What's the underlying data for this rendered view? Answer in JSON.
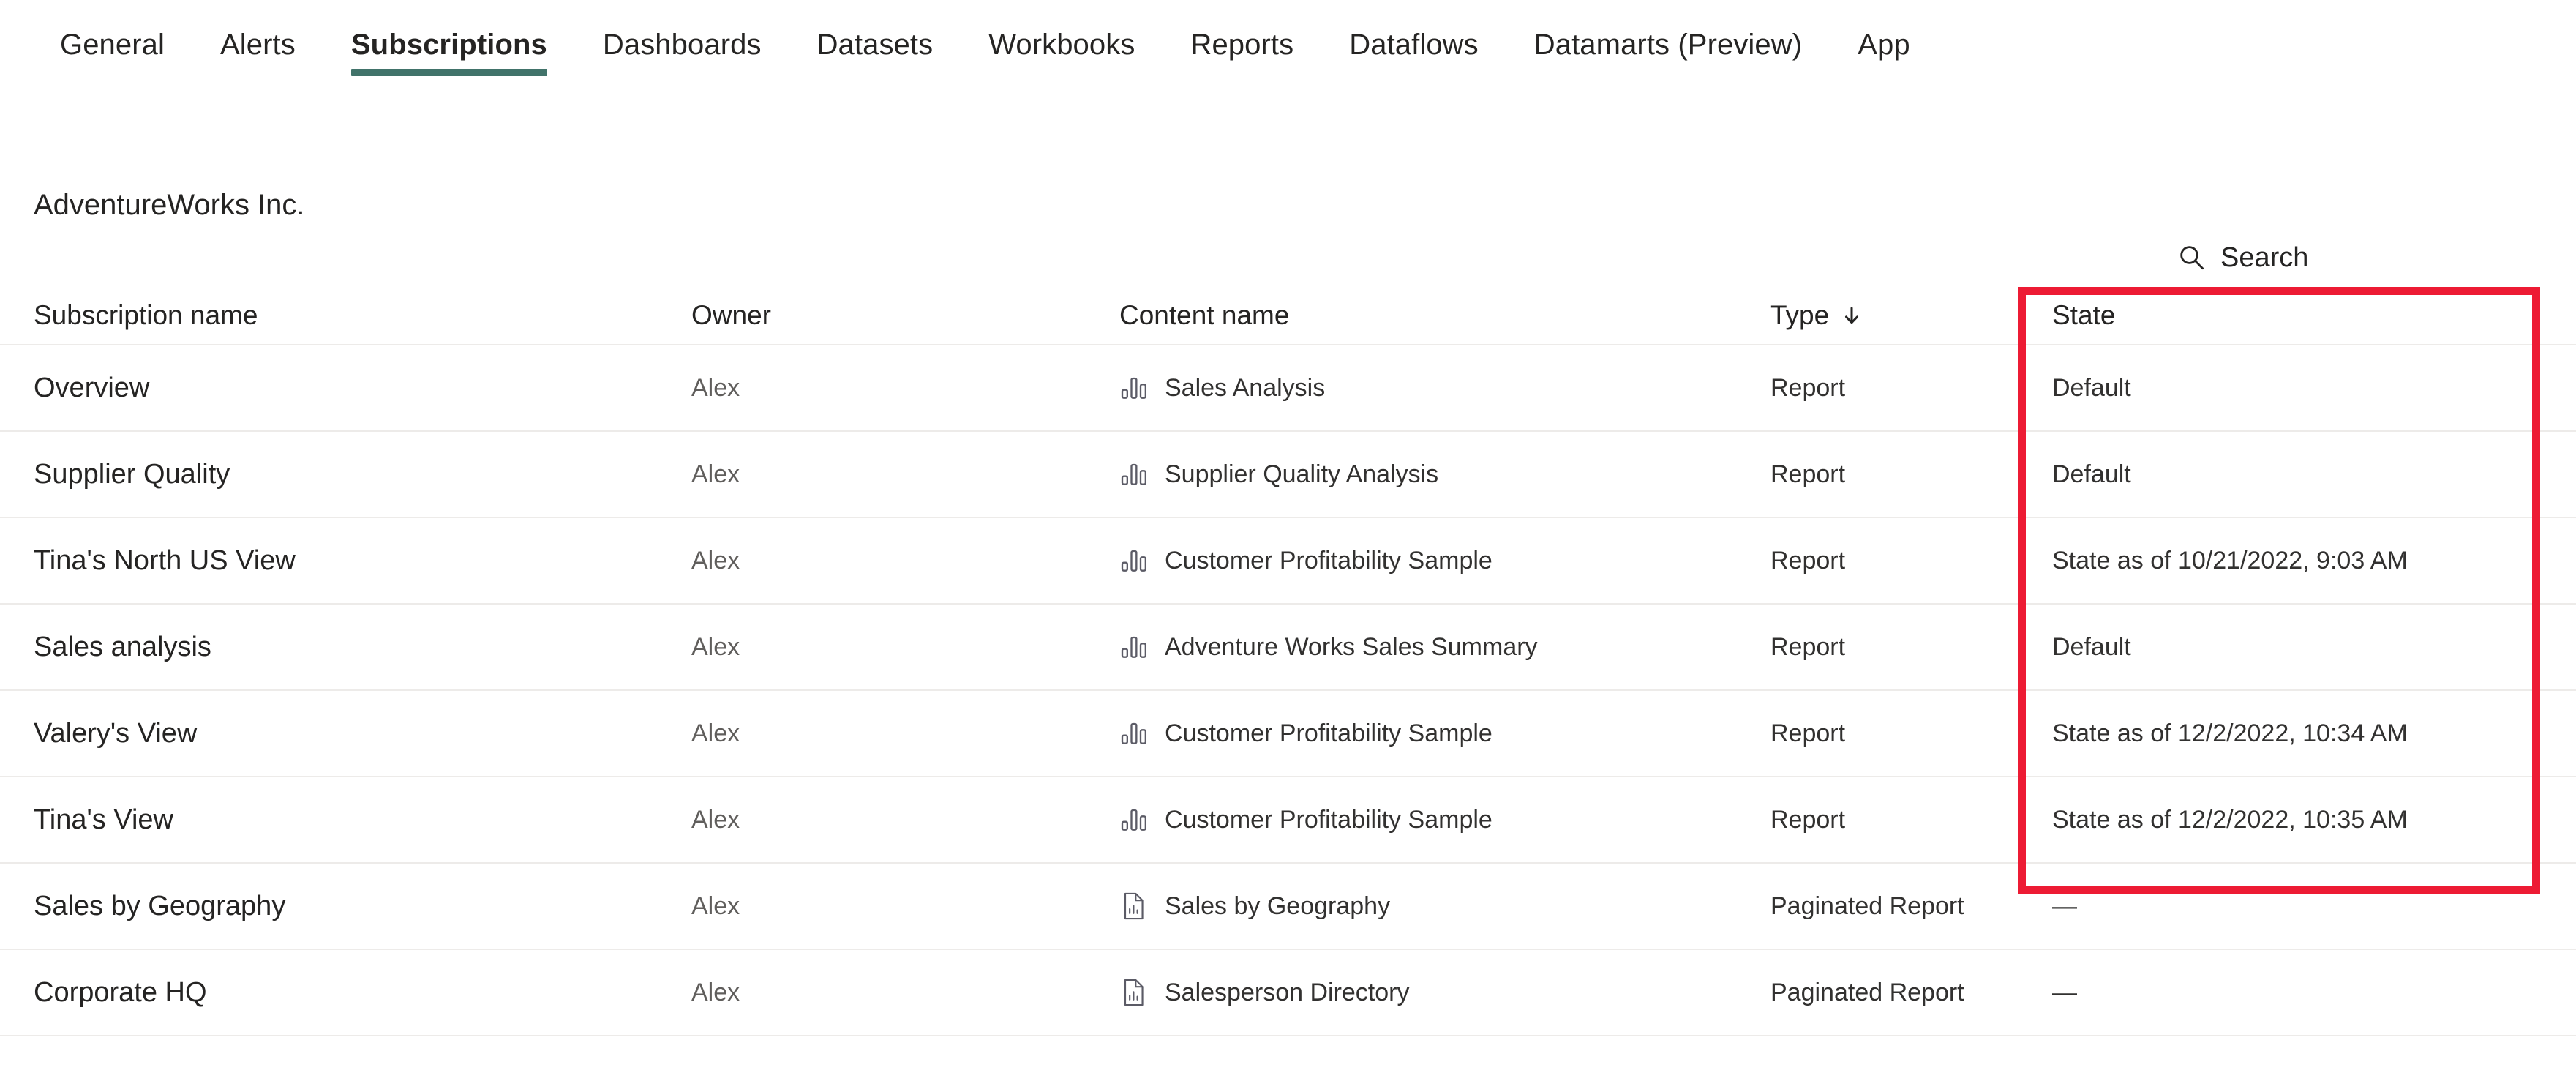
{
  "tabs": [
    {
      "label": "General",
      "active": false
    },
    {
      "label": "Alerts",
      "active": false
    },
    {
      "label": "Subscriptions",
      "active": true
    },
    {
      "label": "Dashboards",
      "active": false
    },
    {
      "label": "Datasets",
      "active": false
    },
    {
      "label": "Workbooks",
      "active": false
    },
    {
      "label": "Reports",
      "active": false
    },
    {
      "label": "Dataflows",
      "active": false
    },
    {
      "label": "Datamarts (Preview)",
      "active": false
    },
    {
      "label": "App",
      "active": false
    }
  ],
  "workspace": {
    "title": "AdventureWorks Inc."
  },
  "search": {
    "placeholder": "Search",
    "icon": "search-icon"
  },
  "table": {
    "columns": [
      {
        "key": "subscription_name",
        "label": "Subscription name",
        "sorted": false
      },
      {
        "key": "owner",
        "label": "Owner",
        "sorted": false
      },
      {
        "key": "content_name",
        "label": "Content name",
        "sorted": false
      },
      {
        "key": "type",
        "label": "Type",
        "sorted": true,
        "sort_direction": "descending",
        "sort_glyph": "↓"
      },
      {
        "key": "state",
        "label": "State",
        "sorted": false
      }
    ],
    "rows": [
      {
        "subscription_name": "Overview",
        "owner": "Alex",
        "content_name": "Sales Analysis",
        "content_icon": "report-bar-chart-icon",
        "type": "Report",
        "state": "Default"
      },
      {
        "subscription_name": "Supplier Quality",
        "owner": "Alex",
        "content_name": "Supplier Quality Analysis",
        "content_icon": "report-bar-chart-icon",
        "type": "Report",
        "state": "Default"
      },
      {
        "subscription_name": "Tina's North US View",
        "owner": "Alex",
        "content_name": "Customer Profitability Sample",
        "content_icon": "report-bar-chart-icon",
        "type": "Report",
        "state": "State as of 10/21/2022, 9:03 AM"
      },
      {
        "subscription_name": "Sales analysis",
        "owner": "Alex",
        "content_name": "Adventure Works Sales Summary",
        "content_icon": "report-bar-chart-icon",
        "type": "Report",
        "state": "Default"
      },
      {
        "subscription_name": "Valery's View",
        "owner": "Alex",
        "content_name": "Customer Profitability Sample",
        "content_icon": "report-bar-chart-icon",
        "type": "Report",
        "state": "State as of 12/2/2022, 10:34 AM"
      },
      {
        "subscription_name": "Tina's View",
        "owner": "Alex",
        "content_name": "Customer Profitability Sample",
        "content_icon": "report-bar-chart-icon",
        "type": "Report",
        "state": "State as of 12/2/2022, 10:35 AM"
      },
      {
        "subscription_name": "Sales by Geography",
        "owner": "Alex",
        "content_name": "Sales by Geography",
        "content_icon": "paginated-report-page-icon",
        "type": "Paginated Report",
        "state": "—"
      },
      {
        "subscription_name": "Corporate HQ",
        "owner": "Alex",
        "content_name": "Salesperson Directory",
        "content_icon": "paginated-report-page-icon",
        "type": "Paginated Report",
        "state": "—"
      }
    ]
  },
  "annotation": {
    "target_column": "State",
    "border_color": "#ED1B34"
  },
  "colors": {
    "accent_tab_underline": "#41736A",
    "annotation_red": "#ED1B34",
    "text_primary": "#252423",
    "text_secondary": "#605E5C",
    "row_divider": "#EDEBE9"
  }
}
